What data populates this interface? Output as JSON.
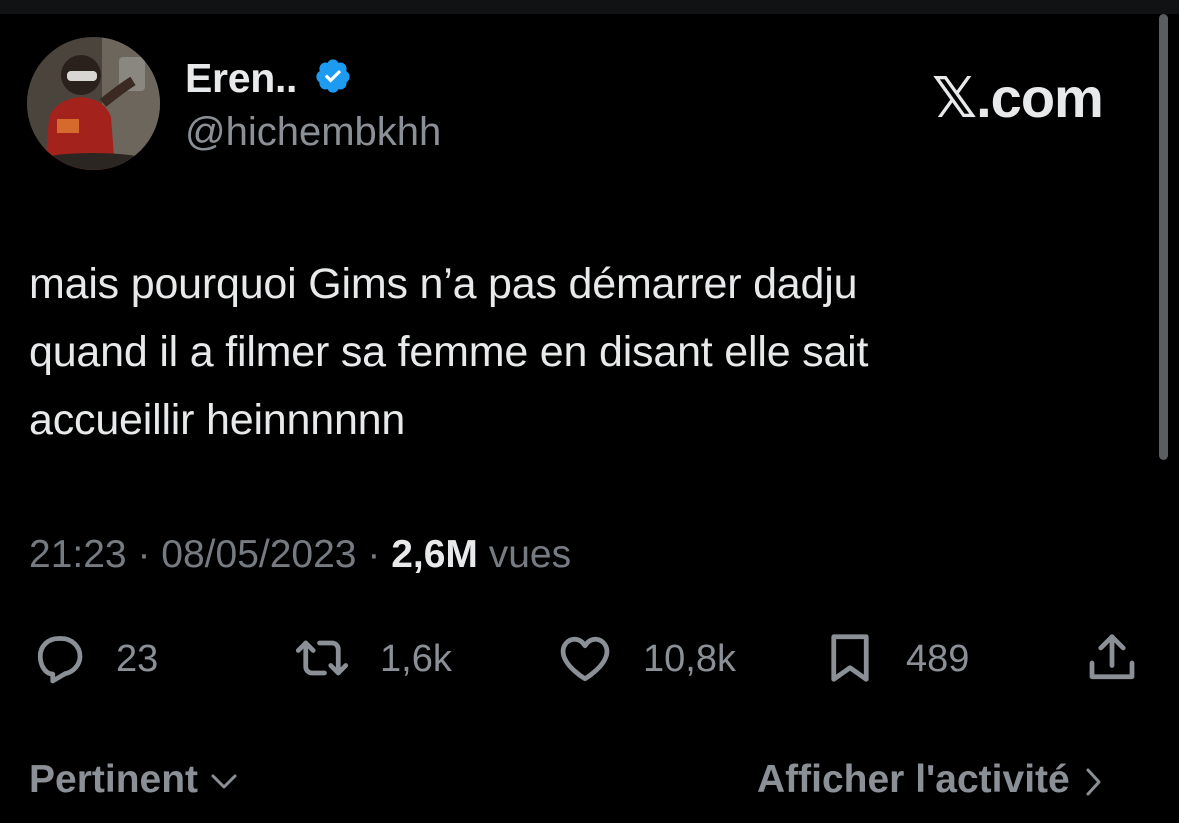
{
  "author": {
    "name": "Eren..",
    "handle": "@hichembkhh",
    "verified": true,
    "verified_color": "#1d9bf0"
  },
  "brand": "𝕏.com",
  "tweet": {
    "lines": [
      "mais pourquoi Gims n’a pas démarrer dadju",
      "quand il a filmer sa femme en disant elle sait",
      "accueillir heinnnnnn"
    ]
  },
  "meta": {
    "time": "21:23",
    "sep1": "·",
    "date": "08/05/2023",
    "sep2": "·",
    "views_count": "2,6M",
    "views_label": "vues"
  },
  "actions": {
    "reply": {
      "icon": "reply-icon",
      "count": "23"
    },
    "repost": {
      "icon": "repost-icon",
      "count": "1,6k"
    },
    "like": {
      "icon": "heart-icon",
      "count": "10,8k"
    },
    "bookmark": {
      "icon": "bookmark-icon",
      "count": "489"
    },
    "share": {
      "icon": "share-icon"
    }
  },
  "footer": {
    "sort_label": "Pertinent",
    "activity_label": "Afficher l'activité"
  },
  "colors": {
    "background": "#000000",
    "text": "#e7e9ea",
    "muted": "#8b9096",
    "accent": "#1d9bf0"
  }
}
